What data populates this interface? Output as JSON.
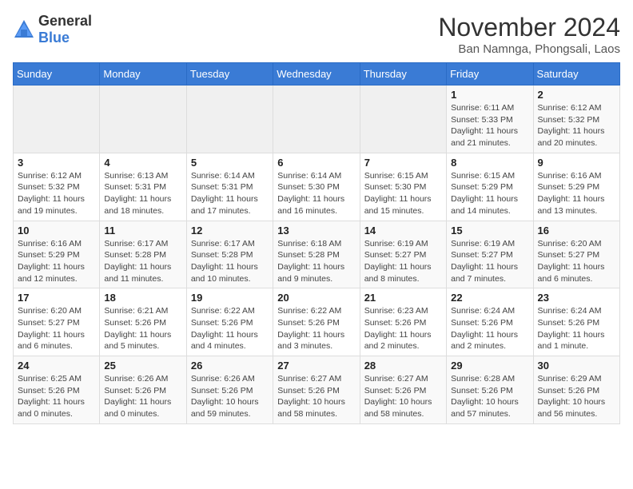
{
  "header": {
    "logo_general": "General",
    "logo_blue": "Blue",
    "month_title": "November 2024",
    "subtitle": "Ban Namnga, Phongsali, Laos"
  },
  "days_of_week": [
    "Sunday",
    "Monday",
    "Tuesday",
    "Wednesday",
    "Thursday",
    "Friday",
    "Saturday"
  ],
  "weeks": [
    [
      {
        "day": "",
        "info": ""
      },
      {
        "day": "",
        "info": ""
      },
      {
        "day": "",
        "info": ""
      },
      {
        "day": "",
        "info": ""
      },
      {
        "day": "",
        "info": ""
      },
      {
        "day": "1",
        "info": "Sunrise: 6:11 AM\nSunset: 5:33 PM\nDaylight: 11 hours and 21 minutes."
      },
      {
        "day": "2",
        "info": "Sunrise: 6:12 AM\nSunset: 5:32 PM\nDaylight: 11 hours and 20 minutes."
      }
    ],
    [
      {
        "day": "3",
        "info": "Sunrise: 6:12 AM\nSunset: 5:32 PM\nDaylight: 11 hours and 19 minutes."
      },
      {
        "day": "4",
        "info": "Sunrise: 6:13 AM\nSunset: 5:31 PM\nDaylight: 11 hours and 18 minutes."
      },
      {
        "day": "5",
        "info": "Sunrise: 6:14 AM\nSunset: 5:31 PM\nDaylight: 11 hours and 17 minutes."
      },
      {
        "day": "6",
        "info": "Sunrise: 6:14 AM\nSunset: 5:30 PM\nDaylight: 11 hours and 16 minutes."
      },
      {
        "day": "7",
        "info": "Sunrise: 6:15 AM\nSunset: 5:30 PM\nDaylight: 11 hours and 15 minutes."
      },
      {
        "day": "8",
        "info": "Sunrise: 6:15 AM\nSunset: 5:29 PM\nDaylight: 11 hours and 14 minutes."
      },
      {
        "day": "9",
        "info": "Sunrise: 6:16 AM\nSunset: 5:29 PM\nDaylight: 11 hours and 13 minutes."
      }
    ],
    [
      {
        "day": "10",
        "info": "Sunrise: 6:16 AM\nSunset: 5:29 PM\nDaylight: 11 hours and 12 minutes."
      },
      {
        "day": "11",
        "info": "Sunrise: 6:17 AM\nSunset: 5:28 PM\nDaylight: 11 hours and 11 minutes."
      },
      {
        "day": "12",
        "info": "Sunrise: 6:17 AM\nSunset: 5:28 PM\nDaylight: 11 hours and 10 minutes."
      },
      {
        "day": "13",
        "info": "Sunrise: 6:18 AM\nSunset: 5:28 PM\nDaylight: 11 hours and 9 minutes."
      },
      {
        "day": "14",
        "info": "Sunrise: 6:19 AM\nSunset: 5:27 PM\nDaylight: 11 hours and 8 minutes."
      },
      {
        "day": "15",
        "info": "Sunrise: 6:19 AM\nSunset: 5:27 PM\nDaylight: 11 hours and 7 minutes."
      },
      {
        "day": "16",
        "info": "Sunrise: 6:20 AM\nSunset: 5:27 PM\nDaylight: 11 hours and 6 minutes."
      }
    ],
    [
      {
        "day": "17",
        "info": "Sunrise: 6:20 AM\nSunset: 5:27 PM\nDaylight: 11 hours and 6 minutes."
      },
      {
        "day": "18",
        "info": "Sunrise: 6:21 AM\nSunset: 5:26 PM\nDaylight: 11 hours and 5 minutes."
      },
      {
        "day": "19",
        "info": "Sunrise: 6:22 AM\nSunset: 5:26 PM\nDaylight: 11 hours and 4 minutes."
      },
      {
        "day": "20",
        "info": "Sunrise: 6:22 AM\nSunset: 5:26 PM\nDaylight: 11 hours and 3 minutes."
      },
      {
        "day": "21",
        "info": "Sunrise: 6:23 AM\nSunset: 5:26 PM\nDaylight: 11 hours and 2 minutes."
      },
      {
        "day": "22",
        "info": "Sunrise: 6:24 AM\nSunset: 5:26 PM\nDaylight: 11 hours and 2 minutes."
      },
      {
        "day": "23",
        "info": "Sunrise: 6:24 AM\nSunset: 5:26 PM\nDaylight: 11 hours and 1 minute."
      }
    ],
    [
      {
        "day": "24",
        "info": "Sunrise: 6:25 AM\nSunset: 5:26 PM\nDaylight: 11 hours and 0 minutes."
      },
      {
        "day": "25",
        "info": "Sunrise: 6:26 AM\nSunset: 5:26 PM\nDaylight: 11 hours and 0 minutes."
      },
      {
        "day": "26",
        "info": "Sunrise: 6:26 AM\nSunset: 5:26 PM\nDaylight: 10 hours and 59 minutes."
      },
      {
        "day": "27",
        "info": "Sunrise: 6:27 AM\nSunset: 5:26 PM\nDaylight: 10 hours and 58 minutes."
      },
      {
        "day": "28",
        "info": "Sunrise: 6:27 AM\nSunset: 5:26 PM\nDaylight: 10 hours and 58 minutes."
      },
      {
        "day": "29",
        "info": "Sunrise: 6:28 AM\nSunset: 5:26 PM\nDaylight: 10 hours and 57 minutes."
      },
      {
        "day": "30",
        "info": "Sunrise: 6:29 AM\nSunset: 5:26 PM\nDaylight: 10 hours and 56 minutes."
      }
    ]
  ]
}
